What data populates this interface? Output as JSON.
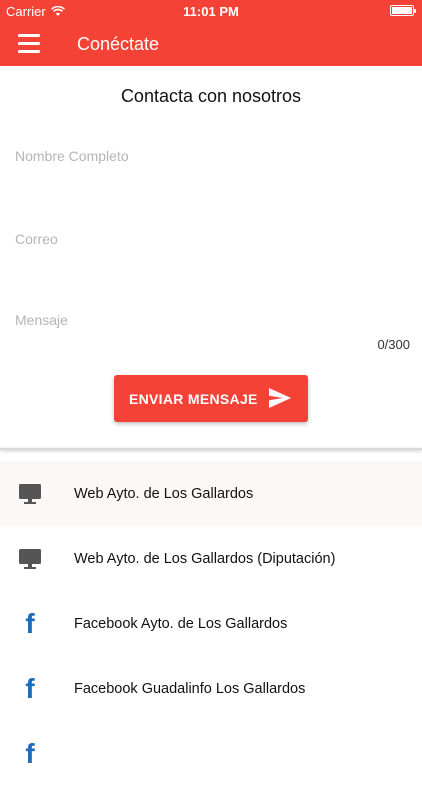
{
  "status_bar": {
    "carrier": "Carrier",
    "time": "11:01 PM"
  },
  "app_bar": {
    "title": "Conéctate",
    "menu_icon": "hamburger-menu-icon"
  },
  "form": {
    "title": "Contacta con nosotros",
    "name_placeholder": "Nombre Completo",
    "email_placeholder": "Correo",
    "message_placeholder": "Mensaje",
    "counter": "0/300",
    "send_label": "ENVIAR MENSAJE"
  },
  "links": [
    {
      "icon": "monitor-icon",
      "label": "Web Ayto. de Los Gallardos"
    },
    {
      "icon": "monitor-icon",
      "label": "Web Ayto. de Los Gallardos (Diputación)"
    },
    {
      "icon": "facebook-icon",
      "label": "Facebook Ayto. de Los Gallardos"
    },
    {
      "icon": "facebook-icon",
      "label": "Facebook Guadalinfo Los Gallardos"
    },
    {
      "icon": "facebook-icon",
      "label": ""
    }
  ],
  "colors": {
    "primary": "#f44336",
    "facebook": "#1f6bb7",
    "monitor": "#555555"
  }
}
